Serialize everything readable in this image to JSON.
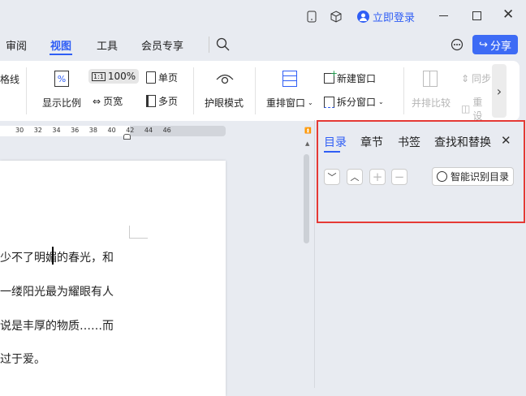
{
  "titlebar": {
    "login": "立即登录"
  },
  "menu": {
    "tabs": [
      "审阅",
      "视图",
      "工具",
      "会员专享"
    ],
    "active": "视图",
    "share": "分享"
  },
  "ribbon": {
    "gridlines": "格线",
    "zoom_ratio": "显示比例",
    "zoom_value": "100%",
    "single_page": "单页",
    "page_width": "页宽",
    "multi_page": "多页",
    "eye_mode": "护眼模式",
    "rearrange": "重排窗口",
    "new_window": "新建窗口",
    "split_window": "拆分窗口",
    "side_by_side": "并排比较",
    "sync": "同步",
    "reset": "重设"
  },
  "ruler": {
    "ticks": [
      "30",
      "32",
      "34",
      "36",
      "38",
      "40",
      "42",
      "44",
      "46"
    ]
  },
  "document": {
    "lines": [
      "少不了明媚的春光，和",
      "一缕阳光最为耀眼有人",
      "说是丰厚的物质……而",
      "过于爱。"
    ]
  },
  "panel": {
    "tabs": [
      "目录",
      "章节",
      "书签",
      "查找和替换"
    ],
    "active": "目录",
    "smart_toc": "智能识别目录"
  },
  "colors": {
    "accent": "#2f5ef5",
    "highlight": "#e53935"
  }
}
